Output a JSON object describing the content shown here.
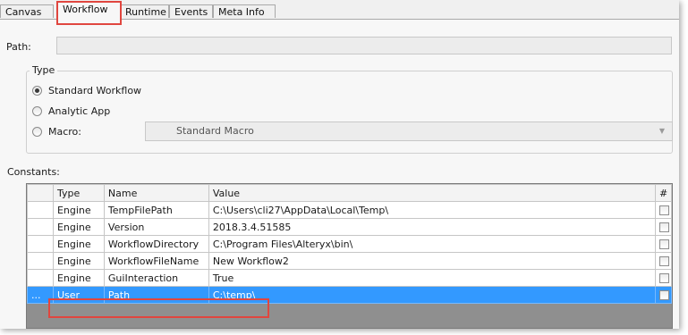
{
  "tabs": [
    {
      "label": "Canvas"
    },
    {
      "label": "Workflow",
      "active": true
    },
    {
      "label": "Runtime"
    },
    {
      "label": "Events"
    },
    {
      "label": "Meta Info"
    }
  ],
  "path": {
    "label": "Path:",
    "value": ""
  },
  "type_group": {
    "title": "Type",
    "options": [
      {
        "label": "Standard Workflow",
        "selected": true
      },
      {
        "label": "Analytic App",
        "selected": false
      },
      {
        "label": "Macro:",
        "selected": false
      }
    ],
    "macro_select": {
      "value": "Standard Macro"
    }
  },
  "constants": {
    "label": "Constants:",
    "columns": [
      "Type",
      "Name",
      "Value",
      "#"
    ],
    "rows": [
      {
        "type": "Engine",
        "name": "TempFilePath",
        "value": "C:\\Users\\cli27\\AppData\\Local\\Temp\\",
        "checked": false
      },
      {
        "type": "Engine",
        "name": "Version",
        "value": "2018.3.4.51585",
        "checked": false
      },
      {
        "type": "Engine",
        "name": "WorkflowDirectory",
        "value": "C:\\Program Files\\Alteryx\\bin\\",
        "checked": false
      },
      {
        "type": "Engine",
        "name": "WorkflowFileName",
        "value": "New Workflow2",
        "checked": false
      },
      {
        "type": "Engine",
        "name": "GuiInteraction",
        "value": "True",
        "checked": false
      },
      {
        "type": "User",
        "name": "Path",
        "value": "C:\\temp\\",
        "checked": false,
        "selected": true,
        "marker": "..."
      }
    ]
  },
  "colors": {
    "highlight": "#e0463f",
    "selection": "#3399ff"
  }
}
